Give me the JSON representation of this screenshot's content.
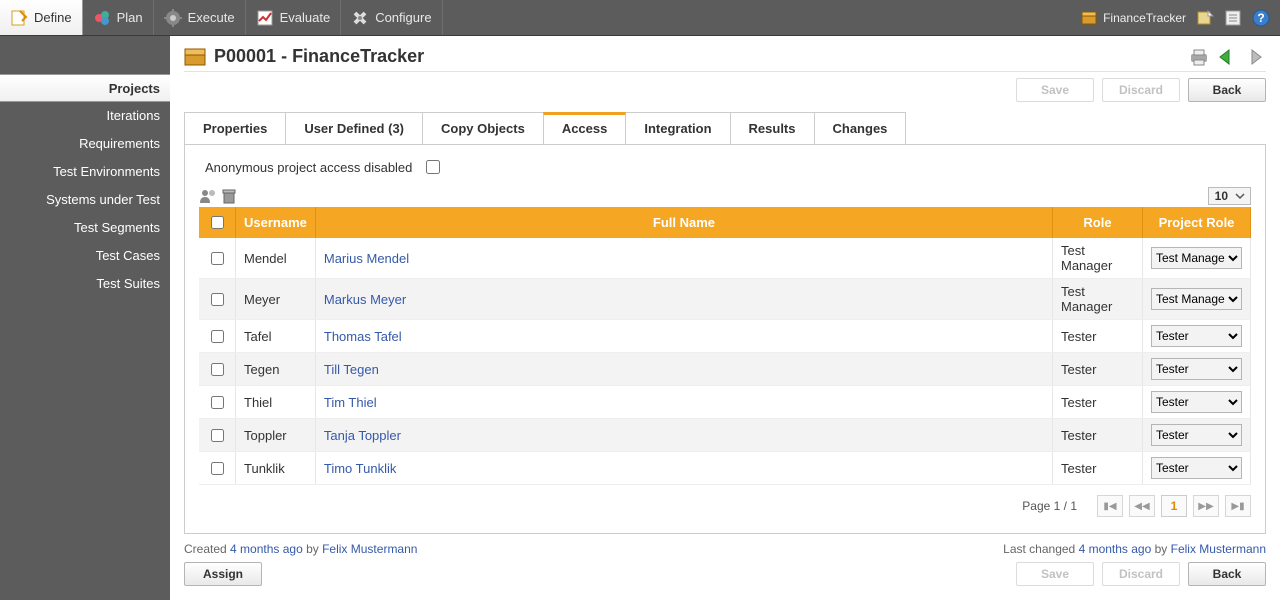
{
  "topnav": {
    "items": [
      {
        "label": "Define",
        "active": true
      },
      {
        "label": "Plan",
        "active": false
      },
      {
        "label": "Execute",
        "active": false
      },
      {
        "label": "Evaluate",
        "active": false
      },
      {
        "label": "Configure",
        "active": false
      }
    ],
    "project_name": "FinanceTracker"
  },
  "sidebar": {
    "items": [
      {
        "label": "Projects",
        "active": true
      },
      {
        "label": "Iterations",
        "active": false
      },
      {
        "label": "Requirements",
        "active": false
      },
      {
        "label": "Test Environments",
        "active": false
      },
      {
        "label": "Systems under Test",
        "active": false
      },
      {
        "label": "Test Segments",
        "active": false
      },
      {
        "label": "Test Cases",
        "active": false
      },
      {
        "label": "Test Suites",
        "active": false
      }
    ]
  },
  "header": {
    "code": "P00001",
    "name": "FinanceTracker"
  },
  "buttons": {
    "save": "Save",
    "discard": "Discard",
    "back": "Back",
    "assign": "Assign"
  },
  "tabs": [
    {
      "label": "Properties",
      "active": false
    },
    {
      "label": "User Defined (3)",
      "active": false
    },
    {
      "label": "Copy Objects",
      "active": false
    },
    {
      "label": "Access",
      "active": true
    },
    {
      "label": "Integration",
      "active": false
    },
    {
      "label": "Results",
      "active": false
    },
    {
      "label": "Changes",
      "active": false
    }
  ],
  "access": {
    "anonymous_label": "Anonymous project access disabled",
    "anonymous_checked": false,
    "page_size": "10",
    "columns": {
      "username": "Username",
      "fullname": "Full Name",
      "role": "Role",
      "project_role": "Project Role"
    },
    "rows": [
      {
        "username": "Mendel",
        "fullname": "Marius Mendel",
        "role": "Test Manager",
        "project_role": "Test Manager"
      },
      {
        "username": "Meyer",
        "fullname": "Markus Meyer",
        "role": "Test Manager",
        "project_role": "Test Manager"
      },
      {
        "username": "Tafel",
        "fullname": "Thomas Tafel",
        "role": "Tester",
        "project_role": "Tester"
      },
      {
        "username": "Tegen",
        "fullname": "Till Tegen",
        "role": "Tester",
        "project_role": "Tester"
      },
      {
        "username": "Thiel",
        "fullname": "Tim Thiel",
        "role": "Tester",
        "project_role": "Tester"
      },
      {
        "username": "Toppler",
        "fullname": "Tanja Toppler",
        "role": "Tester",
        "project_role": "Tester"
      },
      {
        "username": "Tunklik",
        "fullname": "Timo Tunklik",
        "role": "Tester",
        "project_role": "Tester"
      }
    ],
    "pagination": {
      "label": "Page 1 / 1",
      "current": "1"
    }
  },
  "meta": {
    "created_prefix": "Created ",
    "created_time": "4 months ago",
    "created_by_prefix": " by ",
    "created_by": "Felix Mustermann",
    "changed_prefix": "Last changed ",
    "changed_time": "4 months ago",
    "changed_by_prefix": " by ",
    "changed_by": "Felix Mustermann"
  }
}
